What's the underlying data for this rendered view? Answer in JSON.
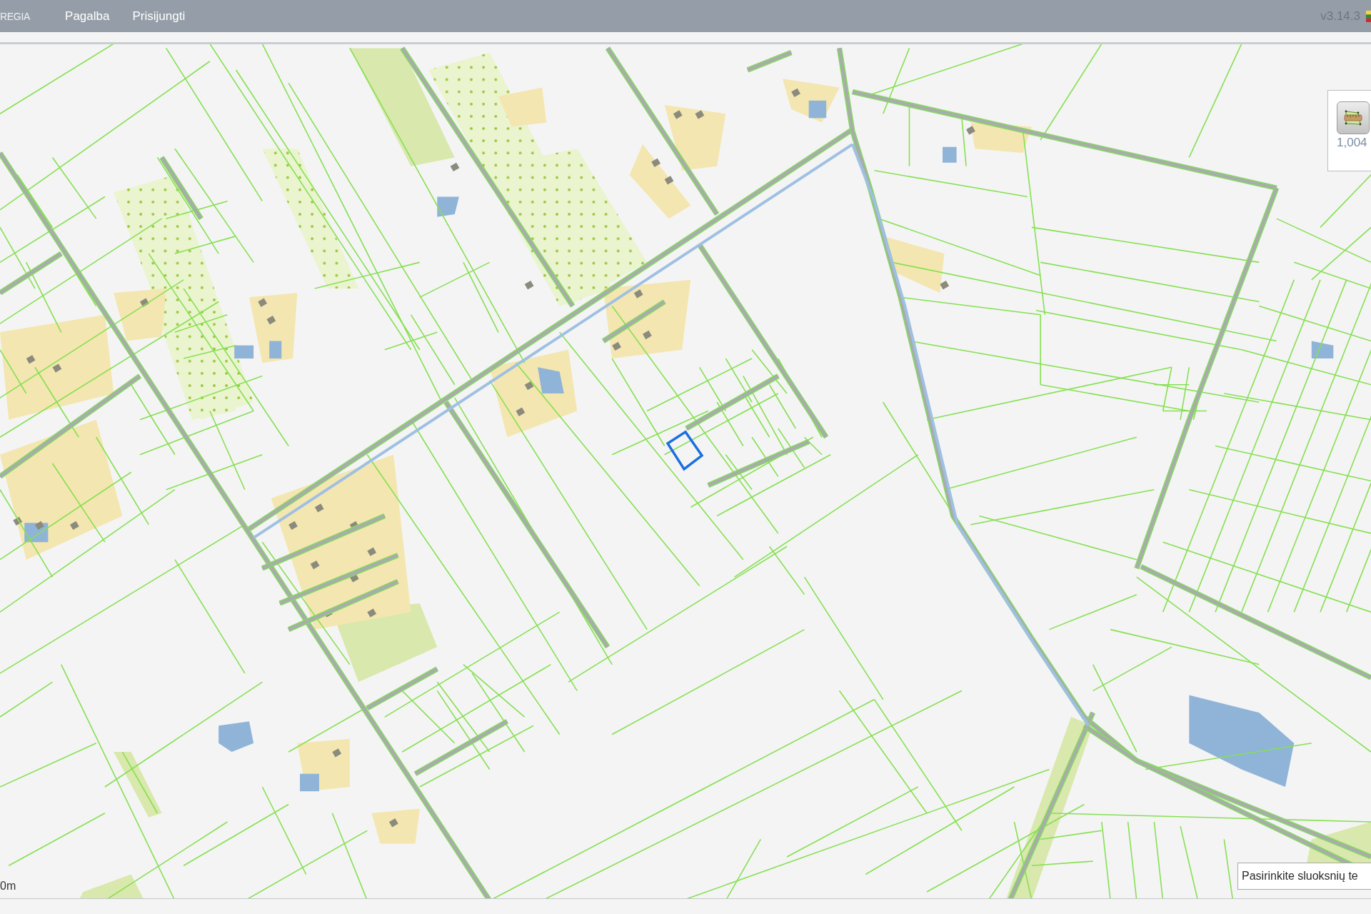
{
  "header": {
    "brand": "REGIA",
    "menu": [
      {
        "label": "Pagalba"
      },
      {
        "label": "Prisijungti"
      }
    ],
    "version": "v3.14.3"
  },
  "map": {
    "measure_panel": {
      "reading": "1,004"
    },
    "scale_bar": {
      "label": "0m"
    },
    "layer_theme_field": {
      "placeholder": "Pasirinkite sluoksnių te"
    }
  }
}
